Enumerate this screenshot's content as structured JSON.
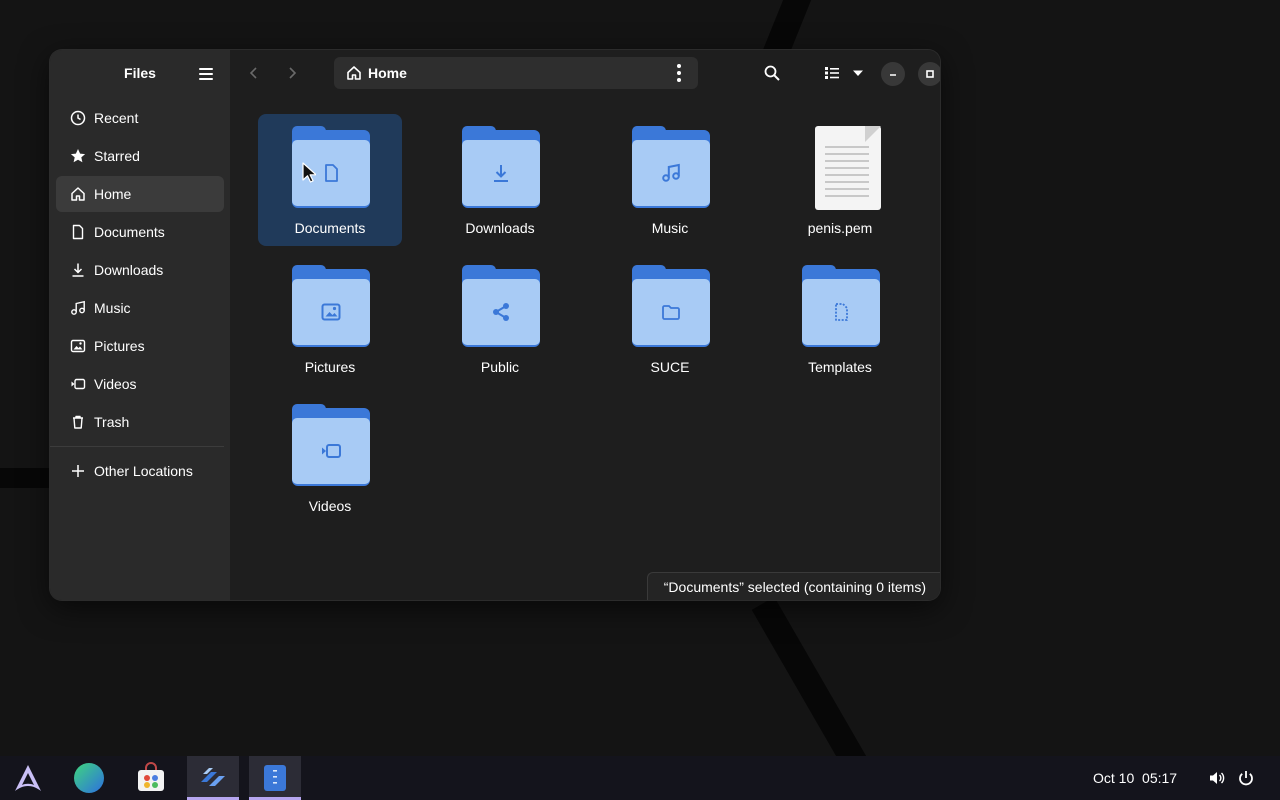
{
  "sidebar": {
    "title": "Files",
    "items": [
      {
        "label": "Recent",
        "icon": "clock-icon"
      },
      {
        "label": "Starred",
        "icon": "star-icon"
      },
      {
        "label": "Home",
        "icon": "home-icon",
        "active": true
      },
      {
        "label": "Documents",
        "icon": "document-icon"
      },
      {
        "label": "Downloads",
        "icon": "download-icon"
      },
      {
        "label": "Music",
        "icon": "music-icon"
      },
      {
        "label": "Pictures",
        "icon": "picture-icon"
      },
      {
        "label": "Videos",
        "icon": "video-icon"
      },
      {
        "label": "Trash",
        "icon": "trash-icon"
      }
    ],
    "other_locations": "Other Locations"
  },
  "pathbar": {
    "current": "Home"
  },
  "files": [
    {
      "name": "Documents",
      "type": "folder",
      "emblem": "document-icon",
      "selected": true
    },
    {
      "name": "Downloads",
      "type": "folder",
      "emblem": "download-icon"
    },
    {
      "name": "Music",
      "type": "folder",
      "emblem": "music-icon"
    },
    {
      "name": "penis.pem",
      "type": "file"
    },
    {
      "name": "Pictures",
      "type": "folder",
      "emblem": "picture-icon"
    },
    {
      "name": "Public",
      "type": "folder",
      "emblem": "share-icon"
    },
    {
      "name": "SUCE",
      "type": "folder",
      "emblem": "folder-icon"
    },
    {
      "name": "Templates",
      "type": "folder",
      "emblem": "template-icon"
    },
    {
      "name": "Videos",
      "type": "folder",
      "emblem": "video-icon"
    }
  ],
  "status": "“Documents” selected  (containing 0 items)",
  "taskbar": {
    "date": "Oct 10",
    "time": "05:17"
  },
  "colors": {
    "accent": "#3b78d8",
    "folder_front": "#a8cbf5",
    "selection": "#203a5a"
  }
}
